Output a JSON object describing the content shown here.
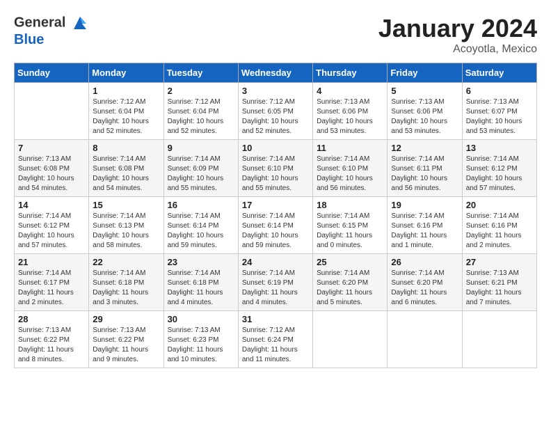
{
  "header": {
    "logo_line1": "General",
    "logo_line2": "Blue",
    "month_title": "January 2024",
    "location": "Acoyotla, Mexico"
  },
  "days_of_week": [
    "Sunday",
    "Monday",
    "Tuesday",
    "Wednesday",
    "Thursday",
    "Friday",
    "Saturday"
  ],
  "weeks": [
    [
      {
        "day": "",
        "sunrise": "",
        "sunset": "",
        "daylight": ""
      },
      {
        "day": "1",
        "sunrise": "Sunrise: 7:12 AM",
        "sunset": "Sunset: 6:04 PM",
        "daylight": "Daylight: 10 hours and 52 minutes."
      },
      {
        "day": "2",
        "sunrise": "Sunrise: 7:12 AM",
        "sunset": "Sunset: 6:04 PM",
        "daylight": "Daylight: 10 hours and 52 minutes."
      },
      {
        "day": "3",
        "sunrise": "Sunrise: 7:12 AM",
        "sunset": "Sunset: 6:05 PM",
        "daylight": "Daylight: 10 hours and 52 minutes."
      },
      {
        "day": "4",
        "sunrise": "Sunrise: 7:13 AM",
        "sunset": "Sunset: 6:06 PM",
        "daylight": "Daylight: 10 hours and 53 minutes."
      },
      {
        "day": "5",
        "sunrise": "Sunrise: 7:13 AM",
        "sunset": "Sunset: 6:06 PM",
        "daylight": "Daylight: 10 hours and 53 minutes."
      },
      {
        "day": "6",
        "sunrise": "Sunrise: 7:13 AM",
        "sunset": "Sunset: 6:07 PM",
        "daylight": "Daylight: 10 hours and 53 minutes."
      }
    ],
    [
      {
        "day": "7",
        "sunrise": "Sunrise: 7:13 AM",
        "sunset": "Sunset: 6:08 PM",
        "daylight": "Daylight: 10 hours and 54 minutes."
      },
      {
        "day": "8",
        "sunrise": "Sunrise: 7:14 AM",
        "sunset": "Sunset: 6:08 PM",
        "daylight": "Daylight: 10 hours and 54 minutes."
      },
      {
        "day": "9",
        "sunrise": "Sunrise: 7:14 AM",
        "sunset": "Sunset: 6:09 PM",
        "daylight": "Daylight: 10 hours and 55 minutes."
      },
      {
        "day": "10",
        "sunrise": "Sunrise: 7:14 AM",
        "sunset": "Sunset: 6:10 PM",
        "daylight": "Daylight: 10 hours and 55 minutes."
      },
      {
        "day": "11",
        "sunrise": "Sunrise: 7:14 AM",
        "sunset": "Sunset: 6:10 PM",
        "daylight": "Daylight: 10 hours and 56 minutes."
      },
      {
        "day": "12",
        "sunrise": "Sunrise: 7:14 AM",
        "sunset": "Sunset: 6:11 PM",
        "daylight": "Daylight: 10 hours and 56 minutes."
      },
      {
        "day": "13",
        "sunrise": "Sunrise: 7:14 AM",
        "sunset": "Sunset: 6:12 PM",
        "daylight": "Daylight: 10 hours and 57 minutes."
      }
    ],
    [
      {
        "day": "14",
        "sunrise": "Sunrise: 7:14 AM",
        "sunset": "Sunset: 6:12 PM",
        "daylight": "Daylight: 10 hours and 57 minutes."
      },
      {
        "day": "15",
        "sunrise": "Sunrise: 7:14 AM",
        "sunset": "Sunset: 6:13 PM",
        "daylight": "Daylight: 10 hours and 58 minutes."
      },
      {
        "day": "16",
        "sunrise": "Sunrise: 7:14 AM",
        "sunset": "Sunset: 6:14 PM",
        "daylight": "Daylight: 10 hours and 59 minutes."
      },
      {
        "day": "17",
        "sunrise": "Sunrise: 7:14 AM",
        "sunset": "Sunset: 6:14 PM",
        "daylight": "Daylight: 10 hours and 59 minutes."
      },
      {
        "day": "18",
        "sunrise": "Sunrise: 7:14 AM",
        "sunset": "Sunset: 6:15 PM",
        "daylight": "Daylight: 11 hours and 0 minutes."
      },
      {
        "day": "19",
        "sunrise": "Sunrise: 7:14 AM",
        "sunset": "Sunset: 6:16 PM",
        "daylight": "Daylight: 11 hours and 1 minute."
      },
      {
        "day": "20",
        "sunrise": "Sunrise: 7:14 AM",
        "sunset": "Sunset: 6:16 PM",
        "daylight": "Daylight: 11 hours and 2 minutes."
      }
    ],
    [
      {
        "day": "21",
        "sunrise": "Sunrise: 7:14 AM",
        "sunset": "Sunset: 6:17 PM",
        "daylight": "Daylight: 11 hours and 2 minutes."
      },
      {
        "day": "22",
        "sunrise": "Sunrise: 7:14 AM",
        "sunset": "Sunset: 6:18 PM",
        "daylight": "Daylight: 11 hours and 3 minutes."
      },
      {
        "day": "23",
        "sunrise": "Sunrise: 7:14 AM",
        "sunset": "Sunset: 6:18 PM",
        "daylight": "Daylight: 11 hours and 4 minutes."
      },
      {
        "day": "24",
        "sunrise": "Sunrise: 7:14 AM",
        "sunset": "Sunset: 6:19 PM",
        "daylight": "Daylight: 11 hours and 4 minutes."
      },
      {
        "day": "25",
        "sunrise": "Sunrise: 7:14 AM",
        "sunset": "Sunset: 6:20 PM",
        "daylight": "Daylight: 11 hours and 5 minutes."
      },
      {
        "day": "26",
        "sunrise": "Sunrise: 7:14 AM",
        "sunset": "Sunset: 6:20 PM",
        "daylight": "Daylight: 11 hours and 6 minutes."
      },
      {
        "day": "27",
        "sunrise": "Sunrise: 7:13 AM",
        "sunset": "Sunset: 6:21 PM",
        "daylight": "Daylight: 11 hours and 7 minutes."
      }
    ],
    [
      {
        "day": "28",
        "sunrise": "Sunrise: 7:13 AM",
        "sunset": "Sunset: 6:22 PM",
        "daylight": "Daylight: 11 hours and 8 minutes."
      },
      {
        "day": "29",
        "sunrise": "Sunrise: 7:13 AM",
        "sunset": "Sunset: 6:22 PM",
        "daylight": "Daylight: 11 hours and 9 minutes."
      },
      {
        "day": "30",
        "sunrise": "Sunrise: 7:13 AM",
        "sunset": "Sunset: 6:23 PM",
        "daylight": "Daylight: 11 hours and 10 minutes."
      },
      {
        "day": "31",
        "sunrise": "Sunrise: 7:12 AM",
        "sunset": "Sunset: 6:24 PM",
        "daylight": "Daylight: 11 hours and 11 minutes."
      },
      {
        "day": "",
        "sunrise": "",
        "sunset": "",
        "daylight": ""
      },
      {
        "day": "",
        "sunrise": "",
        "sunset": "",
        "daylight": ""
      },
      {
        "day": "",
        "sunrise": "",
        "sunset": "",
        "daylight": ""
      }
    ]
  ]
}
